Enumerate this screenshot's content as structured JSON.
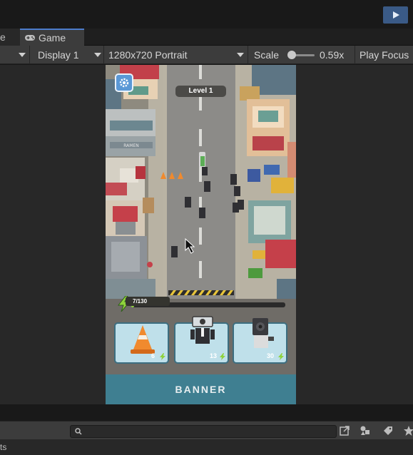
{
  "tabs": {
    "previous_tab_partial": "e",
    "game_tab_label": "Game"
  },
  "toolbar": {
    "display_label": "Display 1",
    "resolution_label": "1280x720 Portrait",
    "scale_label": "Scale",
    "scale_value": "0.59x",
    "play_focus_label": "Play Focus"
  },
  "game": {
    "level_label": "Level 1",
    "energy_text": "7/130",
    "banner_text": "BANNER",
    "cards": [
      {
        "name": "Traffic Cone",
        "cost": "6"
      },
      {
        "name": "Cameraman",
        "cost": "13"
      },
      {
        "name": "Speakerman",
        "cost": "30"
      }
    ],
    "shop_sign": "RAMEN"
  },
  "footer": {
    "partial_text": "ts"
  },
  "colors": {
    "accent": "#4c7ccc",
    "play_button": "#3a5a86",
    "banner": "#3f7f91",
    "card": "#bfe0ea"
  }
}
